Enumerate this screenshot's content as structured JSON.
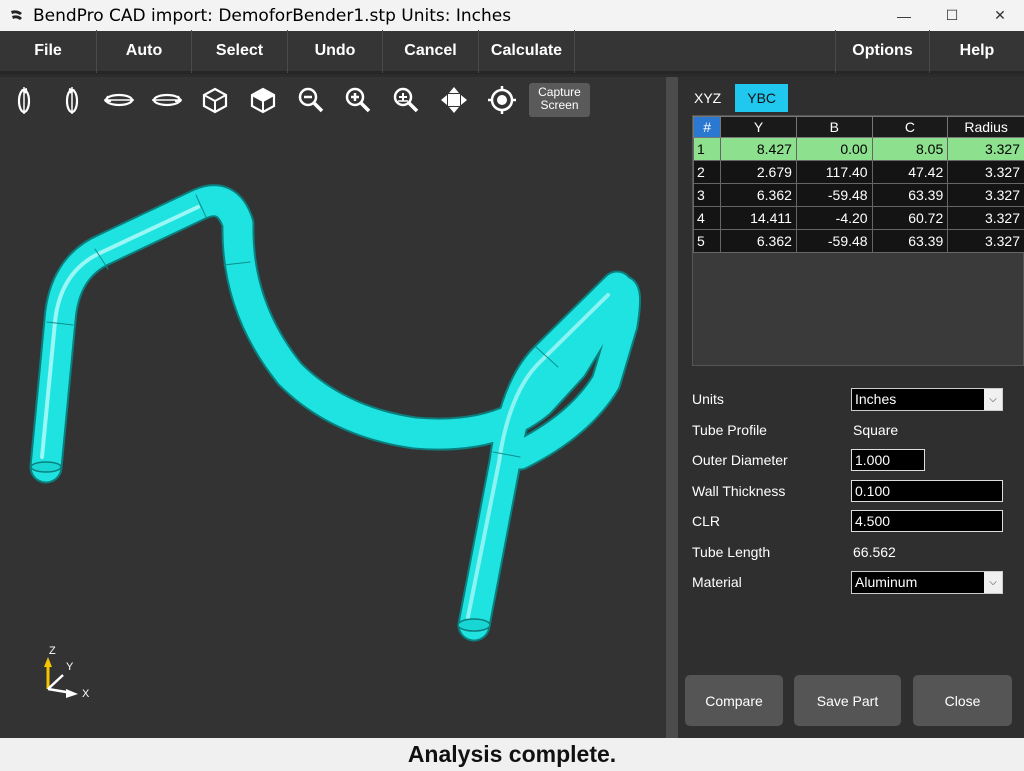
{
  "window": {
    "title": "BendPro CAD import: DemoforBender1.stp  Units: Inches",
    "minimize": "—",
    "maximize": "☐",
    "close": "✕"
  },
  "menu": {
    "items": [
      "File",
      "Auto",
      "Select",
      "Undo",
      "Cancel",
      "Calculate"
    ],
    "right_items": [
      "Options",
      "Help"
    ]
  },
  "toolbar": {
    "icons": [
      "rotate-x-ccw-icon",
      "rotate-x-cw-icon",
      "rotate-y-ccw-icon",
      "rotate-y-cw-icon",
      "cube-front-icon",
      "cube-iso-icon",
      "zoom-out-icon",
      "zoom-in-icon",
      "zoom-fit-icon",
      "pan-icon",
      "center-target-icon"
    ],
    "capture_line1": "Capture",
    "capture_line2": "Screen"
  },
  "axes": {
    "z": "Z",
    "y": "Y",
    "x": "X"
  },
  "tabs": [
    "XYZ",
    "YBC"
  ],
  "active_tab": "YBC",
  "grid": {
    "headers": [
      "#",
      "Y",
      "B",
      "C",
      "Radius"
    ],
    "rows": [
      [
        "1",
        "8.427",
        "0.00",
        "8.05",
        "3.327"
      ],
      [
        "2",
        "2.679",
        "117.40",
        "47.42",
        "3.327"
      ],
      [
        "3",
        "6.362",
        "-59.48",
        "63.39",
        "3.327"
      ],
      [
        "4",
        "14.411",
        "-4.20",
        "60.72",
        "3.327"
      ],
      [
        "5",
        "6.362",
        "-59.48",
        "63.39",
        "3.327"
      ]
    ],
    "selected_row": 1
  },
  "props": {
    "units_label": "Units",
    "units_value": "Inches",
    "profile_label": "Tube Profile",
    "profile_value": "Square",
    "od_label": "Outer Diameter",
    "od_value": "1.000",
    "wall_label": "Wall Thickness",
    "wall_value": "0.100",
    "clr_label": "CLR",
    "clr_value": "4.500",
    "length_label": "Tube Length",
    "length_value": "66.562",
    "material_label": "Material",
    "material_value": "Aluminum"
  },
  "buttons": {
    "compare": "Compare",
    "save": "Save Part",
    "close": "Close"
  },
  "status": "Analysis complete.",
  "colors": {
    "tube": "#1ee3e0",
    "selected_row": "#8de08d",
    "active_tab": "#20c8f0"
  }
}
